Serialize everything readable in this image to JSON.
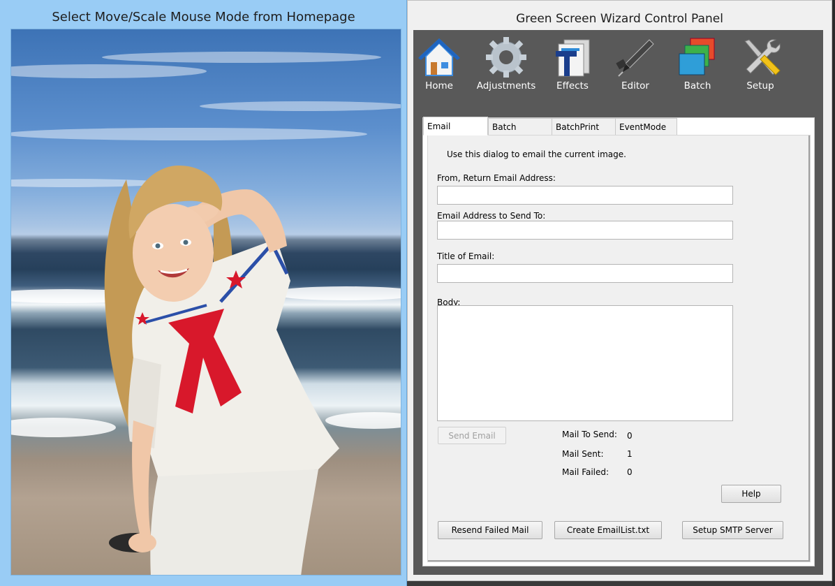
{
  "left_window": {
    "title": "Select Move/Scale Mouse Mode from Homepage"
  },
  "right_window": {
    "title": "Green Screen Wizard Control Panel"
  },
  "toolbar": [
    {
      "label": "Home",
      "icon": "home-icon"
    },
    {
      "label": "Adjustments",
      "icon": "gear-icon"
    },
    {
      "label": "Effects",
      "icon": "effects-icon"
    },
    {
      "label": "Editor",
      "icon": "pen-icon"
    },
    {
      "label": "Batch",
      "icon": "layers-icon"
    },
    {
      "label": "Setup",
      "icon": "tools-icon"
    }
  ],
  "tabs": [
    {
      "label": "Email",
      "active": true
    },
    {
      "label": "Batch",
      "active": false
    },
    {
      "label": "BatchPrint",
      "active": false
    },
    {
      "label": "EventMode",
      "active": false
    }
  ],
  "email": {
    "intro": "Use this dialog to email the current image.",
    "from_label": "From, Return Email Address:",
    "from_value": "",
    "to_label": "Email Address to Send To:",
    "to_value": "",
    "title_label": "Title of Email:",
    "title_value": "",
    "body_label": "Body:",
    "body_value": "",
    "send_button": "Send Email",
    "stats": {
      "to_send_label": "Mail To Send:",
      "to_send_value": "0",
      "sent_label": "Mail Sent:",
      "sent_value": "1",
      "failed_label": "Mail Failed:",
      "failed_value": "0"
    },
    "help_button": "Help",
    "resend_button": "Resend Failed Mail",
    "create_list_button": "Create EmailList.txt",
    "smtp_button": "Setup SMTP Server"
  },
  "colors": {
    "left_frame": "#99ccf5",
    "toolbar_bg": "#595959",
    "panel_bg": "#f0f0f0"
  }
}
